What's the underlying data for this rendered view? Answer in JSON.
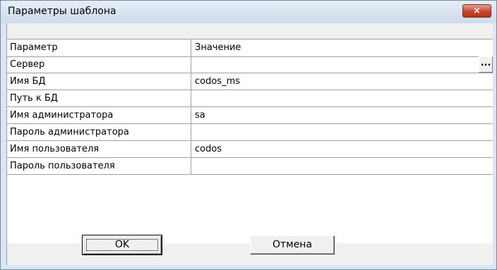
{
  "window": {
    "title": "Параметры шаблона",
    "close_label": "×"
  },
  "grid": {
    "columns": [
      "Параметр",
      "Значение"
    ],
    "rows": [
      {
        "param": "Сервер",
        "value": ""
      },
      {
        "param": "Имя БД",
        "value": "codos_ms"
      },
      {
        "param": "Путь к БД",
        "value": ""
      },
      {
        "param": "Имя администратора",
        "value": "sa"
      },
      {
        "param": "Пароль администратора",
        "value": ""
      },
      {
        "param": "Имя пользователя",
        "value": "codos"
      },
      {
        "param": "Пароль пользователя",
        "value": ""
      }
    ],
    "ellipsis_label": "..."
  },
  "buttons": {
    "ok": "OK",
    "cancel": "Отмена"
  }
}
